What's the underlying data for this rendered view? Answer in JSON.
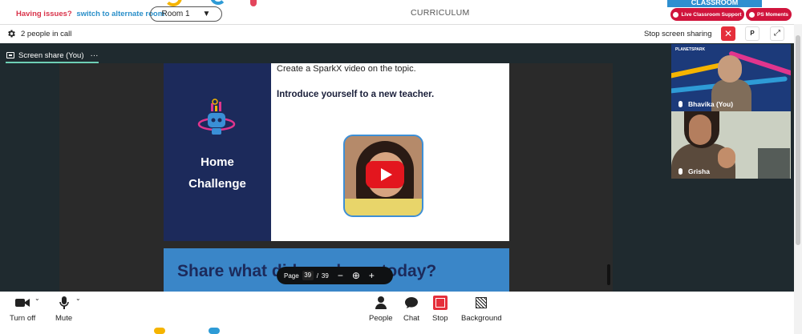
{
  "topbar": {
    "issue_text": "Having issues?",
    "alt_room_link": "switch to alternate room",
    "room_selected": "Room 1",
    "center_title": "CURRICULUM",
    "classroom_banner": "CLASSROOM",
    "live_support": "Live Classroom Support",
    "ps_moments": "PS Moments"
  },
  "callbar": {
    "people_count": "2 people in call",
    "stop_share": "Stop screen sharing",
    "pin_label": "P"
  },
  "stage": {
    "share_tab": "Screen share (You)",
    "share_menu": "···",
    "slide": {
      "left_title_1": "Home",
      "left_title_2": "Challenge",
      "instruction": "Create a SparkX video on the topic.",
      "topic": "Introduce yourself to a new teacher.",
      "next_heading": "Share what did you learn today?"
    },
    "pager": {
      "label": "Page",
      "current": "39",
      "separator": "/",
      "total": "39",
      "zoom_out": "−",
      "zoom_icon": "⊕",
      "zoom_in": "+"
    }
  },
  "participants": [
    {
      "name": "Bhavika (You)",
      "brand": "PLANETSPARK"
    },
    {
      "name": "Grisha"
    }
  ],
  "bottombar": {
    "turn_off": "Turn off",
    "mute": "Mute",
    "people": "People",
    "chat": "Chat",
    "stop": "Stop",
    "background": "Background"
  },
  "colors": {
    "accent_red": "#d0143c",
    "stage_bg": "#1f2a2f",
    "slide_navy": "#1c2a5b",
    "slide_blue": "#3a86c8",
    "link_blue": "#2a8fc9",
    "tab_underline": "#6ecfb5"
  }
}
